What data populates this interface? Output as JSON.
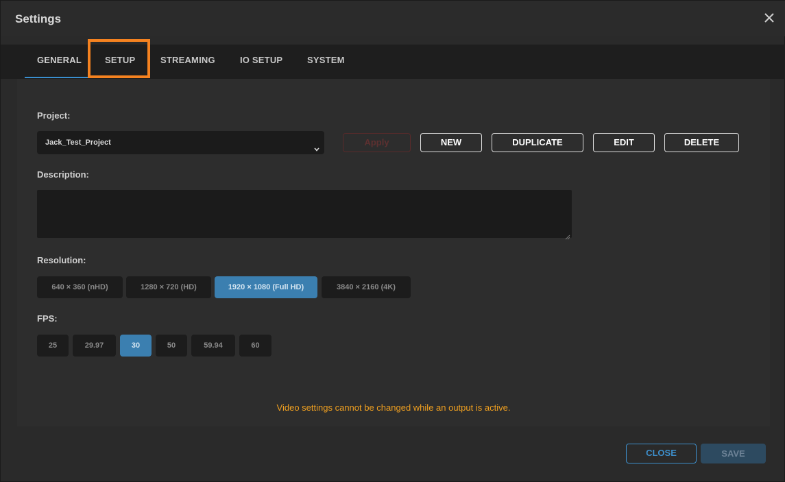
{
  "dialog": {
    "title": "Settings"
  },
  "tabs": [
    {
      "label": "GENERAL"
    },
    {
      "label": "SETUP"
    },
    {
      "label": "STREAMING"
    },
    {
      "label": "IO SETUP"
    },
    {
      "label": "SYSTEM"
    }
  ],
  "active_tab": "GENERAL",
  "project": {
    "label": "Project:",
    "selected": "Jack_Test_Project",
    "apply_label": "Apply",
    "new_label": "NEW",
    "duplicate_label": "DUPLICATE",
    "edit_label": "EDIT",
    "delete_label": "DELETE"
  },
  "description": {
    "label": "Description:",
    "value": ""
  },
  "resolution": {
    "label": "Resolution:",
    "options": [
      "640 × 360 (nHD)",
      "1280 × 720 (HD)",
      "1920 × 1080 (Full HD)",
      "3840 × 2160 (4K)"
    ],
    "selected": "1920 × 1080 (Full HD)"
  },
  "fps": {
    "label": "FPS:",
    "options": [
      "25",
      "29.97",
      "30",
      "50",
      "59.94",
      "60"
    ],
    "selected": "30"
  },
  "warning": "Video settings cannot be changed while an output is active.",
  "footer": {
    "close_label": "CLOSE",
    "save_label": "SAVE"
  },
  "colors": {
    "accent": "#3b7fb0",
    "warning": "#f0a020",
    "highlight": "#f58220"
  },
  "icons": {
    "close": "close-icon",
    "dropdown": "chevron-down-icon"
  }
}
